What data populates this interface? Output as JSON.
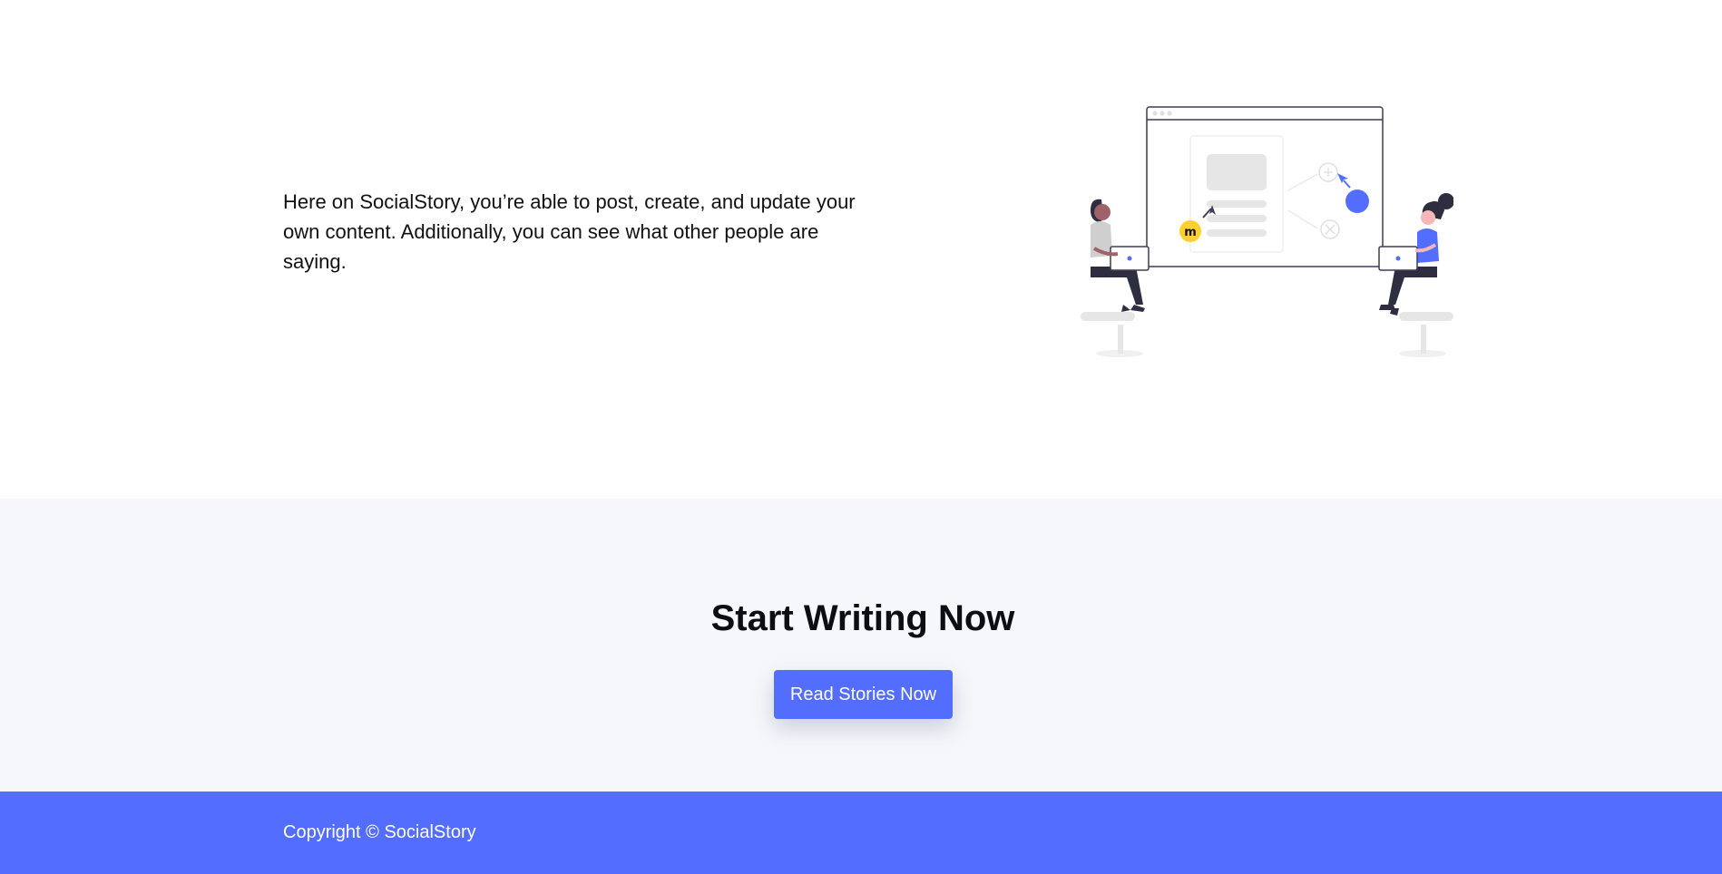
{
  "intro": {
    "text": "Here on SocialStory, you’re able to post, create, and update your own content. Additionally, you can see what other people are saying."
  },
  "cta": {
    "title": "Start Writing Now",
    "button_label": "Read Stories Now"
  },
  "footer": {
    "copyright": "Copyright © SocialStory"
  },
  "colors": {
    "accent": "#536dfe",
    "section_bg": "#f5f7fa",
    "yellow_badge": "#ffd02f",
    "text": "#111111"
  },
  "illustration": {
    "icons": [
      "browser-window-icon",
      "cursor-arrow-icon",
      "plus-circle-icon",
      "x-circle-icon",
      "miro-logo-icon",
      "person-with-laptop-icon"
    ]
  }
}
